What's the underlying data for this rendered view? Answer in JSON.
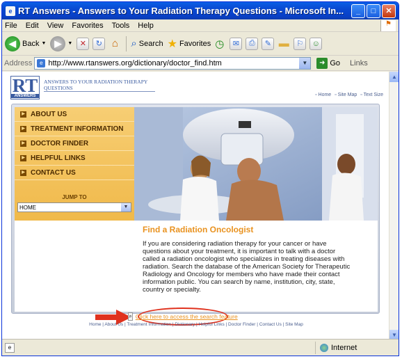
{
  "window": {
    "title": "RT Answers - Answers to Your Radiation Therapy Questions - Microsoft In...",
    "app_icon": "ie-page-icon"
  },
  "menubar": [
    "File",
    "Edit",
    "View",
    "Favorites",
    "Tools",
    "Help"
  ],
  "toolbar": {
    "back_label": "Back",
    "search_label": "Search",
    "favorites_label": "Favorites"
  },
  "addressbar": {
    "label": "Address",
    "url": "http://www.rtanswers.org/dictionary/doctor_find.htm",
    "go_label": "Go",
    "links_label": "Links"
  },
  "site": {
    "logo_text": "RT",
    "logo_subtext": "ANSWERS",
    "tagline": "Answers to your radiation therapy questions",
    "util_links": [
      "Home",
      "Site Map",
      "Text Size"
    ],
    "nav": [
      "ABOUT US",
      "TREATMENT INFORMATION",
      "DOCTOR FINDER",
      "HELPFUL LINKS",
      "CONTACT US"
    ],
    "jump_to_label": "JUMP TO",
    "jump_to_value": "HOME",
    "heading": "Find a Radiation Oncologist",
    "body": "If you are considering radiation therapy for your cancer or have questions about your treatment, it is important to talk with a doctor called a radiation oncologist who specializes in treating diseases with radiation. Search the database of the American Society for Therapeutic Radiology and Oncology for members who have made their contact information public. You can search by name, institution, city, state, country or specialty.",
    "search_link": "Click here to access the search feature",
    "footer": "Home | About Us | Treatment Information | Dictionary | Helpful Links | Doctor Finder | Contact Us | Site Map"
  },
  "status": {
    "zone": "Internet"
  },
  "colors": {
    "accent_orange": "#e9921f",
    "nav_gold": "#f0b94a",
    "annotation_red": "#e0321e",
    "titlebar_blue": "#0a49d1"
  }
}
